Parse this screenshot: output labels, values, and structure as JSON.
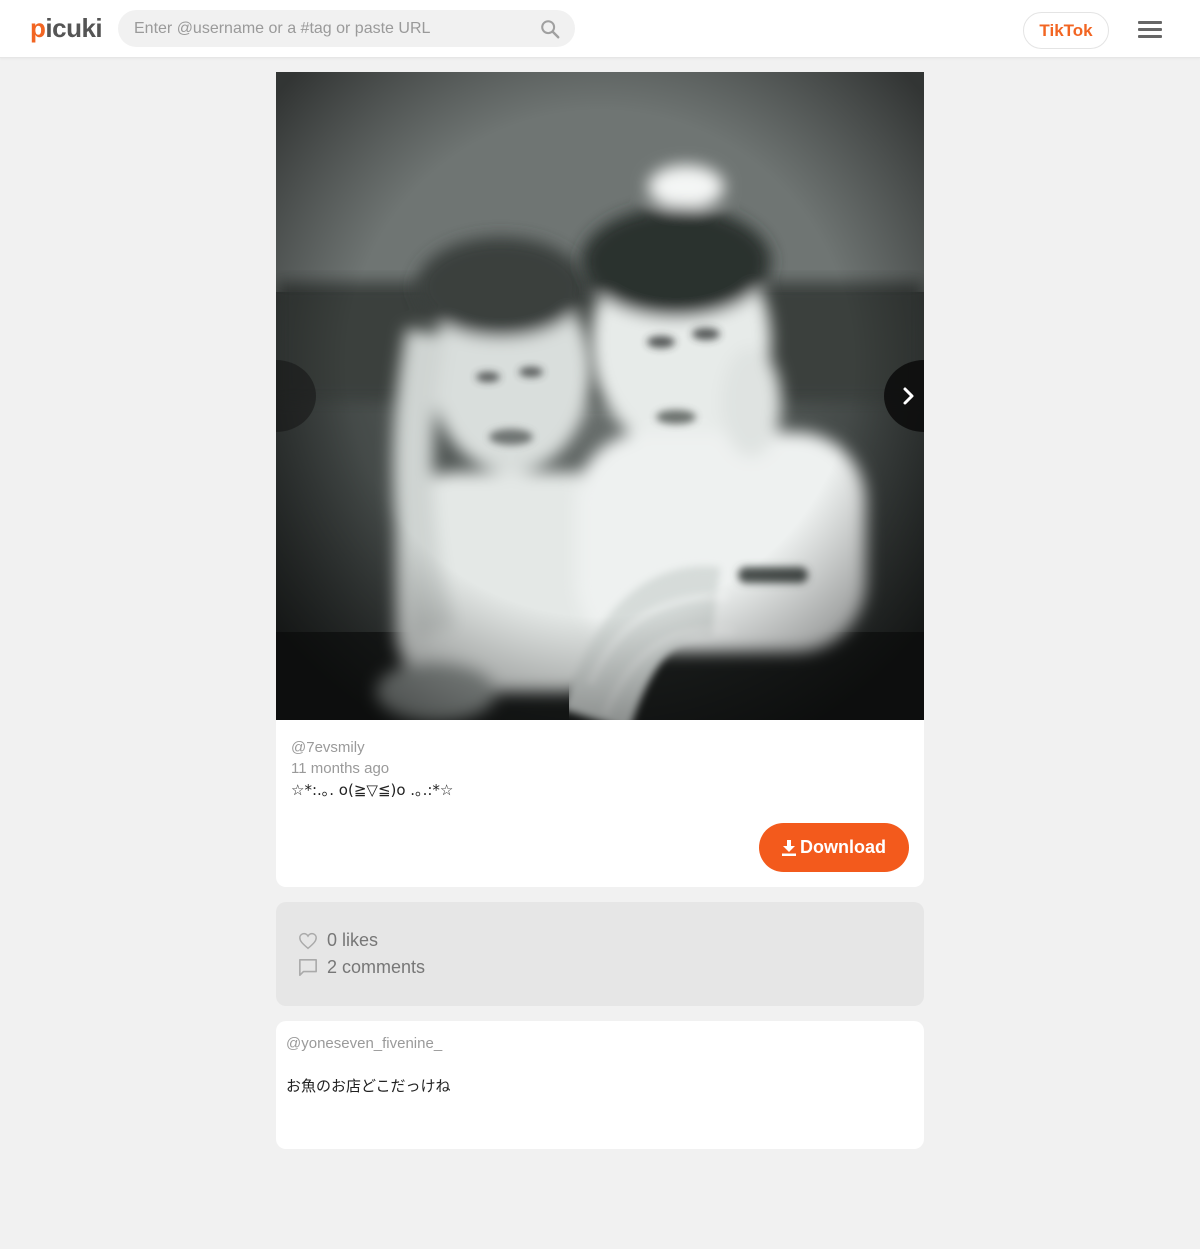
{
  "header": {
    "logo_first": "p",
    "logo_rest": "icuki",
    "search_placeholder": "Enter @username or a #tag or paste URL",
    "tiktok_label": "TikTok",
    "accent": "#f26522"
  },
  "post": {
    "username": "@7evsmily",
    "time_ago": "11 months ago",
    "caption": "☆*:.｡. o(≧▽≦)o .｡.:*☆",
    "download_label": "Download",
    "download_color": "#f35a1c"
  },
  "stats": {
    "likes": "0 likes",
    "comments": "2 comments"
  },
  "comments": [
    {
      "username": "@yoneseven_fivenine_",
      "text": "お魚のお店どこだっけね"
    }
  ]
}
